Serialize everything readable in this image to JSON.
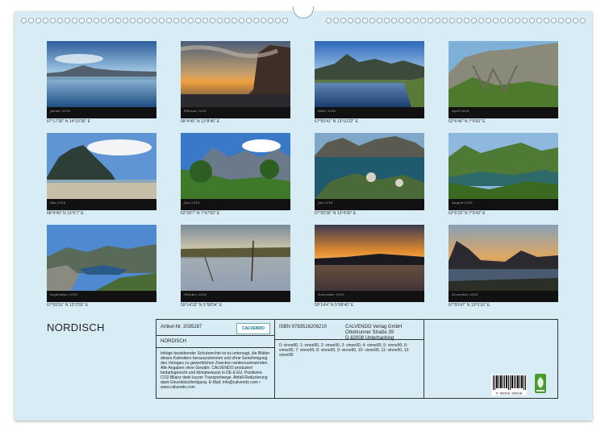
{
  "calendar_title": "NORDISCH",
  "months": [
    {
      "label": "Januar 2016",
      "coords": "67°17'36\" N 14°10'36\" E"
    },
    {
      "label": "Februar 2016",
      "coords": "68°4'45\" N 13°8'46\" E"
    },
    {
      "label": "März 2016",
      "coords": "67°55'41\" N 13°10'22\" E"
    },
    {
      "label": "April 2016",
      "coords": "62°6'46\" N 7°6'60\" E"
    },
    {
      "label": "Mai 2016",
      "coords": "68°4'49\" N 13°6'7\" E"
    },
    {
      "label": "Juni 2016",
      "coords": "62°28'7\" N 7°47'50\" E"
    },
    {
      "label": "Juli 2016",
      "coords": "67°55'36\" N 13°4'30\" E"
    },
    {
      "label": "August 2016",
      "coords": "62°6'33\" N 7°9'42\" E"
    },
    {
      "label": "September 2016",
      "coords": "67°55'51\" N 13°2'55\" E"
    },
    {
      "label": "Oktober 2016",
      "coords": "59°14'32\" N 5°58'54\" E"
    },
    {
      "label": "November 2016",
      "coords": "59°14'4\" N 5°58'40\" E"
    },
    {
      "label": "Dezember 2016",
      "coords": "67°55'47\" N 13°5'16\" E"
    }
  ],
  "info": {
    "article_no": "Artikel-Nr. 2035287",
    "brand_logo": "CALVENDO",
    "product_title": "NORDISCH",
    "isbn": "ISBN 9783516206210",
    "publisher_line1": "CALVENDO Verlag GmbH",
    "publisher_line2": "Ottobrunner Straße 39",
    "publisher_line3": "D-82008 Unterhaching",
    "legal_text": "Infolge bestehender Schutzrechte ist es untersagt, die Blätter dieses Kalenders herauszutrennen und ohne Genehmigung des Verlages zu gewerblichen Zwecken weiterzuverwenden. Alle Angaben ohne Gewähr. CALVENDO produziert bedarfsgerecht und klimabewusst in DE & EU. Positivere CO2-Bilanz dank kurzer Transportwege. Abfall-Reduzierung dank Einzelstückfertigung. E-Mail: info@calvendo.com • www.calvendo.com",
    "code_text": "0: vinne90, 1: vinne90, 2: vinne90, 3: vinne90, 4: vinne90, 5: vinne90, 6: vinne90, 7: vinne90, 8: vinne90, 9: vinne90, 10: vinne90, 11: vinne90, 12: vinne90",
    "barcode_number": "9 783516 206210"
  }
}
